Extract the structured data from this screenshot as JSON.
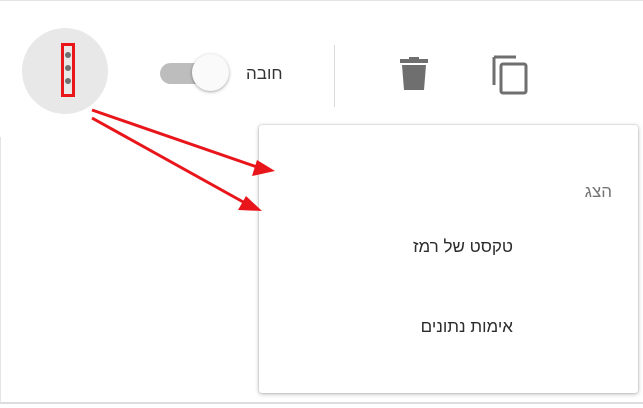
{
  "toolbar": {
    "more_icon": "more-vert-icon",
    "required_label": "חובה",
    "required_on": true,
    "delete_icon": "trash-icon",
    "duplicate_icon": "copy-icon"
  },
  "menu": {
    "header": "הצג",
    "items": [
      {
        "label": "טקסט של רמז"
      },
      {
        "label": "אימות נתונים"
      }
    ]
  },
  "colors": {
    "annotation": "#e8151b",
    "icon_gray": "#6f6f6f",
    "toggle_track": "#bdbdbd",
    "more_button_bg": "#e8e8e8"
  }
}
